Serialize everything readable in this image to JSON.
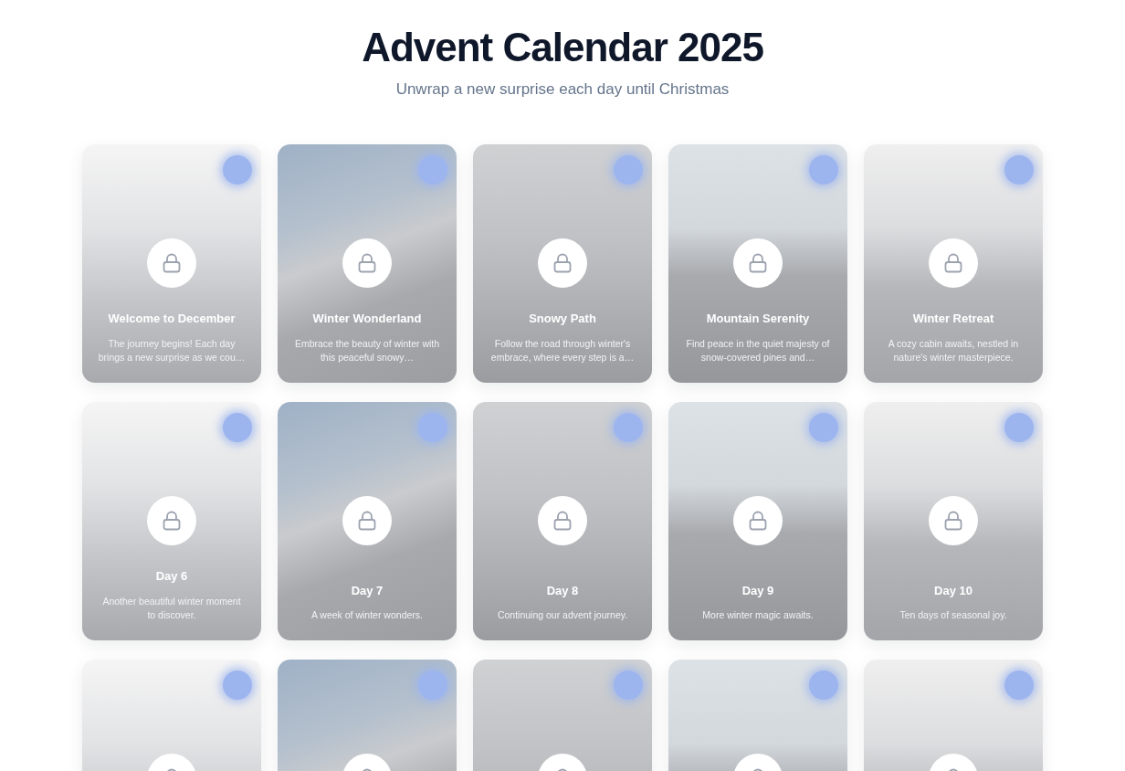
{
  "header": {
    "title": "Advent Calendar 2025",
    "subtitle": "Unwrap a new surprise each day until Christmas"
  },
  "days": [
    {
      "title": "Welcome to December",
      "description": "The journey begins! Each day brings a new surprise as we cou…",
      "locked": true
    },
    {
      "title": "Winter Wonderland",
      "description": "Embrace the beauty of winter with this peaceful snowy…",
      "locked": true
    },
    {
      "title": "Snowy Path",
      "description": "Follow the road through winter's embrace, where every step is a…",
      "locked": true
    },
    {
      "title": "Mountain Serenity",
      "description": "Find peace in the quiet majesty of snow-covered pines and…",
      "locked": true
    },
    {
      "title": "Winter Retreat",
      "description": "A cozy cabin awaits, nestled in nature's winter masterpiece.",
      "locked": true
    },
    {
      "title": "Day 6",
      "description": "Another beautiful winter moment to discover.",
      "locked": true
    },
    {
      "title": "Day 7",
      "description": "A week of winter wonders.",
      "locked": true
    },
    {
      "title": "Day 8",
      "description": "Continuing our advent journey.",
      "locked": true
    },
    {
      "title": "Day 9",
      "description": "More winter magic awaits.",
      "locked": true
    },
    {
      "title": "Day 10",
      "description": "Ten days of seasonal joy.",
      "locked": true
    },
    {
      "locked": true
    },
    {
      "locked": true
    },
    {
      "locked": true
    },
    {
      "locked": true
    },
    {
      "locked": true
    }
  ]
}
